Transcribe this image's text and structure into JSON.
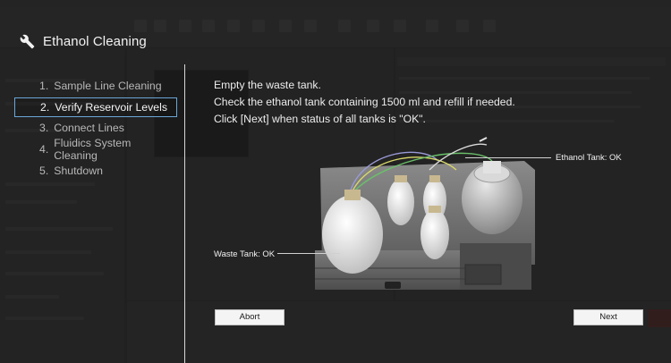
{
  "dialog": {
    "title": "Ethanol Cleaning",
    "icon": "wrench-icon"
  },
  "steps": [
    {
      "num": "1.",
      "label": "Sample Line Cleaning",
      "active": false
    },
    {
      "num": "2.",
      "label": "Verify Reservoir Levels",
      "active": true
    },
    {
      "num": "3.",
      "label": "Connect Lines",
      "active": false
    },
    {
      "num": "4.",
      "label": "Fluidics System Cleaning",
      "active": false
    },
    {
      "num": "5.",
      "label": "Shutdown",
      "active": false
    }
  ],
  "instructions": {
    "line1": "Empty the waste tank.",
    "line2": "Check the ethanol tank containing 1500 ml and refill if needed.",
    "line3": "Click [Next] when status of all tanks is \"OK\"."
  },
  "labels": {
    "ethanol_tank": "Ethanol Tank: OK",
    "waste_tank": "Waste Tank: OK"
  },
  "buttons": {
    "abort": "Abort",
    "next": "Next"
  },
  "colors": {
    "active_step_border": "#6aa7d8",
    "overlay": "#1a1a1a"
  }
}
